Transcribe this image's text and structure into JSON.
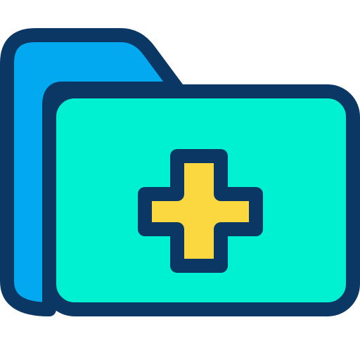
{
  "icon": {
    "name": "medical-folder-add-icon",
    "colors": {
      "outline": "#0b3764",
      "back_panel": "#03a9f0",
      "front_panel": "#00f0d2",
      "plus_fill": "#fcd840"
    }
  }
}
